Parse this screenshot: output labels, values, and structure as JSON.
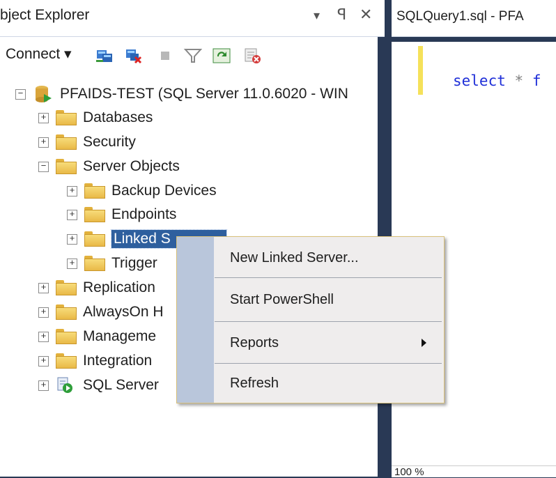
{
  "object_explorer": {
    "title": "bject Explorer",
    "controls": {
      "dropdown": "▾",
      "pin": "ꟼ",
      "close": "✕"
    },
    "toolbar": {
      "connect_label": "Connect ▾"
    },
    "tree": [
      {
        "label": "PFAIDS-TEST (SQL Server 11.0.6020 - WIN",
        "expander": "−"
      },
      {
        "label": "Databases",
        "expander": "+"
      },
      {
        "label": "Security",
        "expander": "+"
      },
      {
        "label": "Server Objects",
        "expander": "−"
      },
      {
        "label": "Backup Devices",
        "expander": "+"
      },
      {
        "label": "Endpoints",
        "expander": "+"
      },
      {
        "label": "Linked S",
        "expander": "+"
      },
      {
        "label": "Trigger",
        "expander": "+"
      },
      {
        "label": "Replication",
        "expander": "+"
      },
      {
        "label": "AlwaysOn H",
        "expander": "+"
      },
      {
        "label": "Manageme",
        "expander": "+"
      },
      {
        "label": "Integration",
        "expander": "+"
      },
      {
        "label": "SQL Server",
        "expander": "+"
      }
    ]
  },
  "editor": {
    "tab_title": "SQLQuery1.sql - PFA",
    "code": {
      "keyword": "select",
      "star": "*",
      "rest": "f"
    },
    "zoom": "100 %"
  },
  "context_menu": {
    "items": [
      {
        "label": "New Linked Server..."
      },
      {
        "label": "Start PowerShell"
      },
      {
        "label": "Reports"
      },
      {
        "label": "Refresh"
      }
    ]
  },
  "colors": {
    "accent": "#293955",
    "selection": "#2e5f9e",
    "menu_gutter": "#b9c6db"
  }
}
